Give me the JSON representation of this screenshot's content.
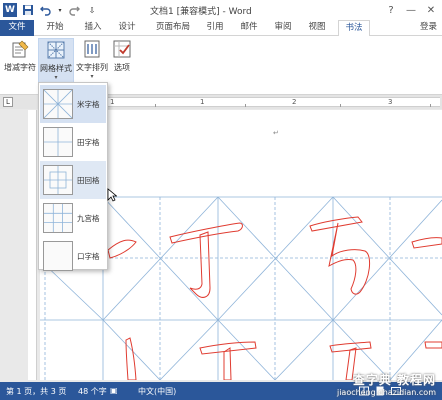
{
  "window": {
    "title": "文档1 [兼容模式] - Word",
    "controls": {
      "help": "?",
      "minimize": "—",
      "close": "✕"
    }
  },
  "tabs": [
    {
      "label": "文件",
      "kind": "file"
    },
    {
      "label": "开始"
    },
    {
      "label": "插入"
    },
    {
      "label": "设计"
    },
    {
      "label": "页面布局"
    },
    {
      "label": "引用"
    },
    {
      "label": "邮件"
    },
    {
      "label": "审阅"
    },
    {
      "label": "视图"
    },
    {
      "label": "书法",
      "active": true
    }
  ],
  "account": {
    "login_label": "登录"
  },
  "ribbon": {
    "buttons": [
      {
        "label": "增减字符",
        "icon": "add-remove-chars-icon"
      },
      {
        "label": "网格样式",
        "icon": "grid-style-icon",
        "pressed": true
      },
      {
        "label": "文字排列",
        "icon": "text-arrange-icon"
      },
      {
        "label": "选项",
        "icon": "options-icon"
      }
    ]
  },
  "ruler": {
    "labels": [
      "1",
      "1",
      "2",
      "3"
    ]
  },
  "grid_menu": {
    "items": [
      {
        "label": "米字格",
        "icon": "mi-grid-icon",
        "state": "selected"
      },
      {
        "label": "田字格",
        "icon": "tian-grid-icon"
      },
      {
        "label": "田回格",
        "icon": "tian-hui-grid-icon",
        "state": "hover"
      },
      {
        "label": "九宫格",
        "icon": "nine-grid-icon"
      },
      {
        "label": "口字格",
        "icon": "kou-grid-icon"
      }
    ]
  },
  "status": {
    "page": "第 1 页，共 3 页",
    "words": "48 个字",
    "language": "中文(中国)"
  },
  "watermark": {
    "line1": "查字典 教程网",
    "line2": "jiaocheng.chazidian.com"
  },
  "colors": {
    "brand": "#2b579a",
    "grid_line": "#8fb4d9",
    "calligraphy_outline": "#e03c31",
    "selected_item": "#d5e1f2"
  }
}
